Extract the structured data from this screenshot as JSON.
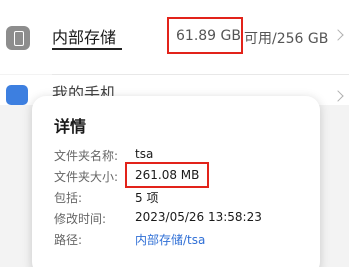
{
  "storage": {
    "title": "内部存储",
    "used": "61.89 GB",
    "available": "可用/256 GB"
  },
  "second_row": {
    "label": "我的手机"
  },
  "details": {
    "title": "详情",
    "rows": [
      {
        "label": "文件夹名称:",
        "value": "tsa"
      },
      {
        "label": "文件夹大小:",
        "value": "261.08 MB"
      },
      {
        "label": "包括:",
        "value": "5 项"
      },
      {
        "label": "修改时间:",
        "value": "2023/05/26 13:58:23"
      },
      {
        "label": "路径:",
        "value": "内部存储/tsa"
      }
    ]
  },
  "colors": {
    "highlight_box": "#e2231a",
    "link": "#2f6fd6"
  }
}
